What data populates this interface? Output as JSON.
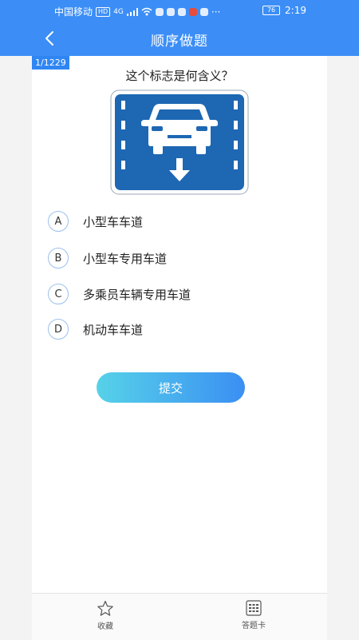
{
  "status_bar": {
    "carrier": "中国移动",
    "network_badge": "HD",
    "network_type": "4G",
    "battery_level": "76",
    "time": "2:19",
    "more": "···"
  },
  "nav": {
    "title": "顺序做题",
    "back_icon": "chevron-left-icon"
  },
  "question": {
    "counter": "1/1229",
    "text": "这个标志是何含义？",
    "sign_icon": "small-car-lane-sign"
  },
  "options": [
    {
      "letter": "A",
      "text": "小型车车道"
    },
    {
      "letter": "B",
      "text": "小型车专用车道"
    },
    {
      "letter": "C",
      "text": "多乘员车辆专用车道"
    },
    {
      "letter": "D",
      "text": "机动车车道"
    }
  ],
  "submit_label": "提交",
  "bottom_tabs": [
    {
      "label": "收藏",
      "icon": "star-icon"
    },
    {
      "label": "答题卡",
      "icon": "grid-icon"
    }
  ],
  "colors": {
    "primary": "#3c8ef6",
    "sign_blue": "#1d67b3",
    "button_start": "#56d2e8",
    "button_end": "#3b8ff3"
  }
}
